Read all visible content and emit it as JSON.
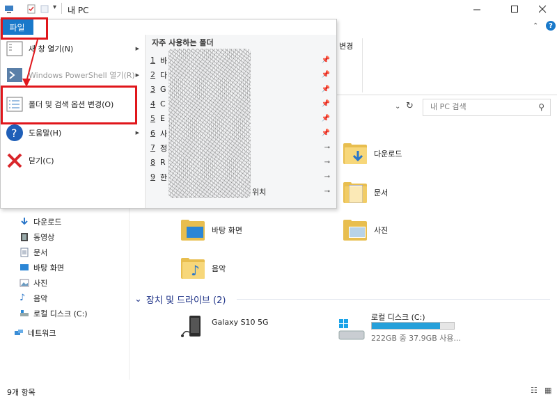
{
  "window": {
    "title": "내 PC"
  },
  "ribbon": {
    "change_label": "변경"
  },
  "search": {
    "placeholder": "내 PC 검색"
  },
  "file_menu": {
    "tab_label": "파일",
    "items": [
      {
        "label": "새 창 열기",
        "shortcut": "(N)",
        "icon": "new-window-icon",
        "has_submenu": true
      },
      {
        "label": "Windows PowerShell 열기",
        "shortcut": "(R)",
        "icon": "powershell-icon",
        "has_submenu": true,
        "disabled": true
      },
      {
        "label": "폴더 및 검색 옵션 변경",
        "shortcut": "(O)",
        "icon": "folder-options-icon",
        "highlighted": true
      },
      {
        "label": "도움말",
        "shortcut": "(H)",
        "icon": "help-icon",
        "has_submenu": true
      },
      {
        "label": "닫기",
        "shortcut": "(C)",
        "icon": "close-icon"
      }
    ],
    "recent_title": "자주 사용하는 폴더",
    "recent": [
      {
        "num": "1",
        "text": "바",
        "pinned": true
      },
      {
        "num": "2",
        "text": "다",
        "pinned": true
      },
      {
        "num": "3",
        "text": "G",
        "pinned": true
      },
      {
        "num": "4",
        "text": "C",
        "pinned": true
      },
      {
        "num": "5",
        "text": "E",
        "pinned": true
      },
      {
        "num": "6",
        "text": "사",
        "pinned": true
      },
      {
        "num": "7",
        "text": "정",
        "pinned": false
      },
      {
        "num": "8",
        "text": "R",
        "pinned": false
      },
      {
        "num": "9",
        "text": "한",
        "pinned": false
      },
      {
        "num": "",
        "text": "위치",
        "pinned": false
      }
    ]
  },
  "nav": {
    "items": [
      {
        "label": "다운로드",
        "icon": "download-icon"
      },
      {
        "label": "동영상",
        "icon": "video-icon"
      },
      {
        "label": "문서",
        "icon": "document-icon"
      },
      {
        "label": "바탕 화면",
        "icon": "desktop-icon"
      },
      {
        "label": "사진",
        "icon": "pictures-icon"
      },
      {
        "label": "음악",
        "icon": "music-icon"
      },
      {
        "label": "로컬 디스크 (C:)",
        "icon": "drive-icon"
      },
      {
        "label": "네트워크",
        "icon": "network-icon"
      }
    ]
  },
  "content": {
    "folders": [
      {
        "label": "다운로드"
      },
      {
        "label": "문서"
      },
      {
        "label": "바탕 화면"
      },
      {
        "label": "사진"
      },
      {
        "label": "음악"
      }
    ],
    "devices_header": "장치 및 드라이브 (2)",
    "devices": [
      {
        "label": "Galaxy S10 5G"
      },
      {
        "label": "로컬 디스크 (C:)",
        "detail": "222GB 중 37.9GB 사용...",
        "used_fraction": 0.83
      }
    ]
  },
  "status": {
    "items_count": "9개 항목"
  },
  "colors": {
    "accent": "#1979ca",
    "highlight": "#e0161b",
    "folder": "#f7d77a",
    "drive_bar": "#26a0da"
  }
}
